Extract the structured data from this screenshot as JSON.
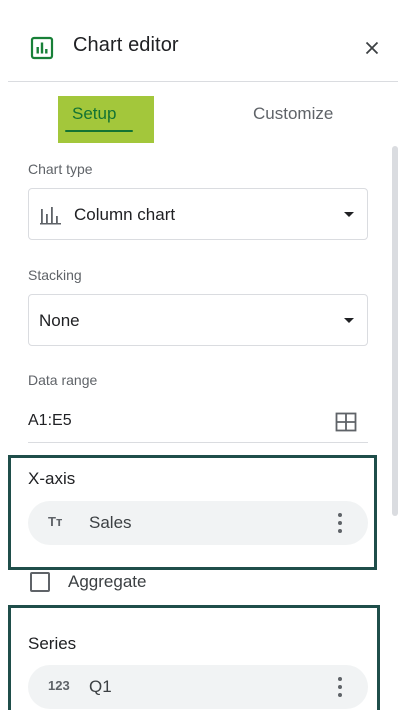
{
  "header": {
    "title": "Chart editor",
    "icon": "chart-editor-icon",
    "close_icon": "close-icon"
  },
  "tabs": [
    {
      "label": "Setup",
      "selected": true
    },
    {
      "label": "Customize",
      "selected": false
    }
  ],
  "chart_type": {
    "label": "Chart type",
    "value": "Column chart",
    "icon": "column-chart-icon"
  },
  "stacking": {
    "label": "Stacking",
    "value": "None"
  },
  "data_range": {
    "label": "Data range",
    "value": "A1:E5",
    "icon": "grid-select-icon"
  },
  "x_axis": {
    "title": "X-axis",
    "chip": {
      "icon_text": "Tт",
      "label": "Sales"
    }
  },
  "aggregate": {
    "label": "Aggregate",
    "checked": false
  },
  "series": {
    "title": "Series",
    "chip": {
      "icon_text": "123",
      "label": "Q1"
    }
  },
  "colors": {
    "accent_green": "#137333",
    "highlight": "#a3c73b",
    "annotation_box": "#1f4e4a"
  }
}
